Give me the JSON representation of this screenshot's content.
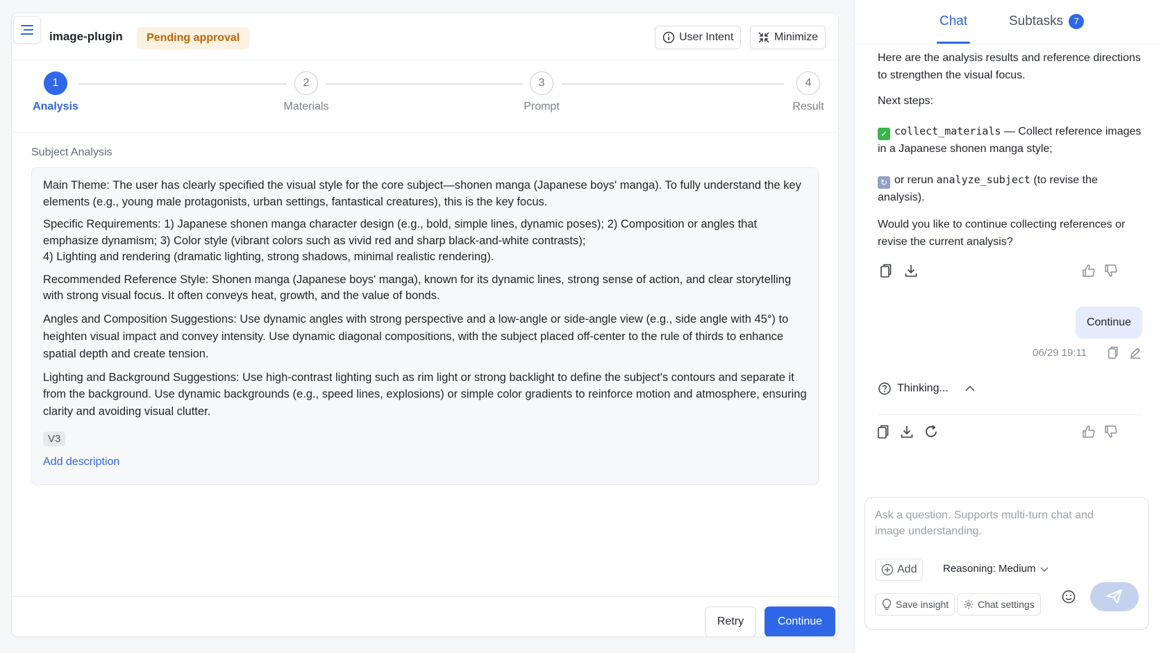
{
  "header": {
    "plugin_name": "image-plugin",
    "status": "Pending approval",
    "user_intent_label": "User Intent",
    "minimize_label": "Minimize"
  },
  "steps": [
    {
      "number": "1",
      "label": "Analysis",
      "active": true
    },
    {
      "number": "2",
      "label": "Materials",
      "active": false
    },
    {
      "number": "3",
      "label": "Prompt",
      "active": false
    },
    {
      "number": "4",
      "label": "Result",
      "active": false
    }
  ],
  "analysis": {
    "section_title": "Subject Analysis",
    "paragraphs": [
      "Main Theme: The user has clearly specified the visual style for the core subject—shonen manga (Japanese boys' manga). To fully understand the key elements (e.g., young male protagonists, urban settings, fantastical creatures), this is the key focus.",
      "Specific Requirements: 1) Japanese shonen manga character design (e.g., bold, simple lines, dynamic poses); 2) Composition or angles that emphasize dynamism; 3) Color style (vibrant colors such as vivid red and sharp black-and-white contrasts);\n4) Lighting and rendering (dramatic lighting, strong shadows, minimal realistic rendering).",
      "Recommended Reference Style: Shonen manga (Japanese boys' manga), known for its dynamic lines, strong sense of action, and clear storytelling with strong visual focus. It often conveys heat, growth, and the value of bonds.",
      "Angles and Composition Suggestions: Use dynamic angles with strong perspective and a low-angle or side-angle view (e.g., side angle with 45°) to heighten visual impact and convey intensity. Use dynamic diagonal compositions, with the subject placed off-center to the rule of thirds to enhance spatial depth and create tension.",
      "Lighting and Background Suggestions: Use high-contrast lighting such as rim light or strong backlight to define the subject's contours and separate it from the background. Use dynamic backgrounds (e.g., speed lines, explosions) or simple color gradients to reinforce motion and atmosphere, ensuring clarity and avoiding visual clutter."
    ],
    "version": "V3",
    "add_description": "Add description"
  },
  "footer": {
    "retry_label": "Retry",
    "continue_label": "Continue"
  },
  "chat": {
    "tabs": {
      "chat": "Chat",
      "subtasks": "Subtasks",
      "subtasks_count": "7"
    },
    "assistant_intro": "Here are the analysis results and reference directions to strengthen the visual focus.",
    "next_steps_label": "Next steps:",
    "step1_code": "collect_materials",
    "step1_text": " — Collect reference images in a Japanese shonen manga style;",
    "step2_prefix": "or rerun ",
    "step2_code": "analyze_subject",
    "step2_text": " (to revise the analysis).",
    "question": "Would you like to continue collecting references or revise the current analysis?",
    "user_message": "Continue",
    "timestamp": "06/29 19:11",
    "thinking_label": "Thinking...",
    "composer": {
      "placeholder": "Ask a question. Supports multi-turn chat and image understanding.",
      "add_label": "Add",
      "reasoning_label": "Reasoning: Medium",
      "save_insight_label": "Save insight",
      "chat_settings_label": "Chat settings"
    }
  },
  "colors": {
    "accent": "#2f67e8",
    "pending_bg": "#fdf1e1",
    "pending_text": "#b8690a"
  }
}
